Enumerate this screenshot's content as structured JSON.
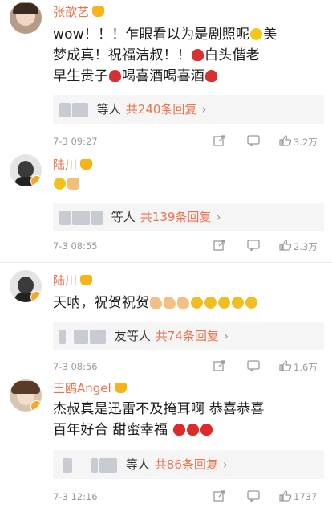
{
  "comments": [
    {
      "username": "张歆艺",
      "text_line1": "wow！！！乍眼看以为是剧照呢",
      "text_line1b": "美",
      "text_line2a": "梦成真！祝福洁叔！！",
      "text_line2b": "白头偕老",
      "text_line3a": "早生贵子",
      "text_line3b": "喝喜酒喝喜酒",
      "replies_who": "等人",
      "replies_count": "共240条回复",
      "time": "7-3 09:27",
      "likes": "3.2万"
    },
    {
      "username": "陆川",
      "replies_who": "等人",
      "replies_count": "共139条回复",
      "time": "7-3 08:55",
      "likes": "2.3万"
    },
    {
      "username": "陆川",
      "text_line1": "天呐，祝贺祝贺",
      "replies_who": "友等人",
      "replies_count": "共74条回复",
      "time": "7-3 08:56",
      "likes": "1.6万"
    },
    {
      "username": "王鸥Angel",
      "text_line1": "杰叔真是迅雷不及掩耳啊 恭喜恭喜",
      "text_line2": "百年好合 甜蜜幸福",
      "replies_who": "等人",
      "replies_count": "共86条回复",
      "time": "7-3 12:16",
      "likes": "1737"
    }
  ],
  "chevron": "›",
  "icons": {
    "crown": "crown-vip-icon",
    "verified": "verified-badge-icon",
    "share": "share-icon",
    "comment": "comment-icon",
    "like": "thumbs-up-icon",
    "rose": "rose-emoji-icon",
    "laugh": "laughing-emoji-icon",
    "grin": "grin-emoji-icon",
    "thumb": "thumbs-up-emoji-icon",
    "muscle": "muscle-emoji-icon",
    "kiss": "kiss-emoji-icon",
    "heart": "red-heart-emoji-icon"
  },
  "colors": {
    "username": "#eb7350",
    "reply_count": "#eb7350",
    "meta": "#9a9a9a",
    "reply_bg": "#f5f5f5"
  }
}
